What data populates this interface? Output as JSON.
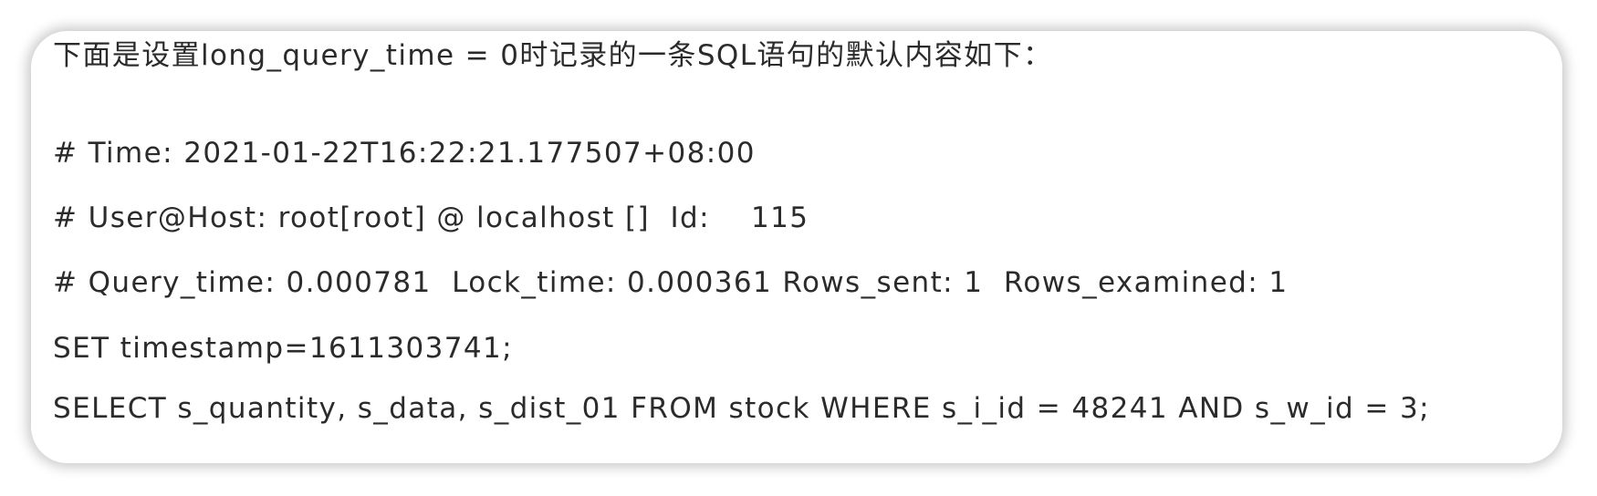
{
  "intro": "下面是设置long_query_time = 0时记录的一条SQL语句的默认内容如下：",
  "log": {
    "time": "# Time: 2021-01-22T16:22:21.177507+08:00",
    "user_host": "# User@Host: root[root] @ localhost []  Id:    115",
    "query_stats": "# Query_time: 0.000781  Lock_time: 0.000361 Rows_sent: 1  Rows_examined: 1",
    "set_timestamp": "SET timestamp=1611303741;",
    "statement": "SELECT s_quantity, s_data, s_dist_01 FROM stock WHERE s_i_id = 48241 AND s_w_id = 3;"
  }
}
